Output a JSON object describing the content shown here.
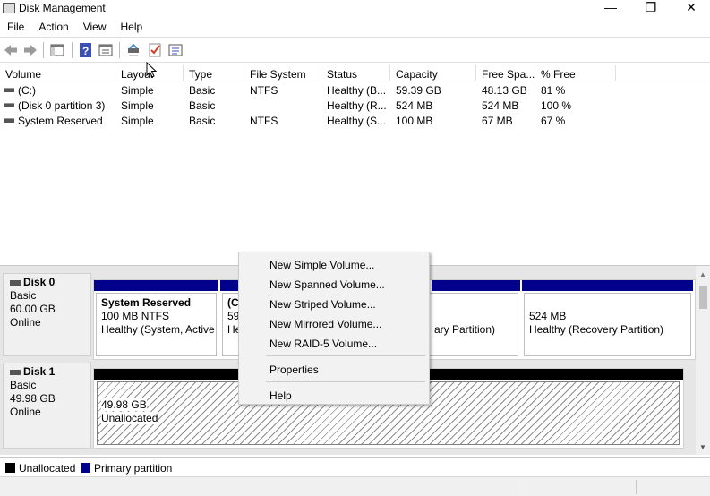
{
  "window": {
    "title": "Disk Management",
    "minimize_glyph": "—",
    "maximize_glyph": "❐",
    "close_glyph": "✕"
  },
  "menu": [
    "File",
    "Action",
    "View",
    "Help"
  ],
  "toolbar": {
    "icons": [
      "back-icon",
      "forward-icon",
      "show-hide-console-tree-icon",
      "help-icon",
      "properties-icon",
      "connect-disk-icon",
      "check-icon",
      "list-icon"
    ]
  },
  "volume_list": {
    "columns": [
      "Volume",
      "Layout",
      "Type",
      "File System",
      "Status",
      "Capacity",
      "Free Spa...",
      "% Free"
    ],
    "rows": [
      {
        "volume": "(C:)",
        "layout": "Simple",
        "type": "Basic",
        "fs": "NTFS",
        "status": "Healthy (B...",
        "capacity": "59.39 GB",
        "free": "48.13 GB",
        "pct": "81 %"
      },
      {
        "volume": "(Disk 0 partition 3)",
        "layout": "Simple",
        "type": "Basic",
        "fs": "",
        "status": "Healthy (R...",
        "capacity": "524 MB",
        "free": "524 MB",
        "pct": "100 %"
      },
      {
        "volume": "System Reserved",
        "layout": "Simple",
        "type": "Basic",
        "fs": "NTFS",
        "status": "Healthy (S...",
        "capacity": "100 MB",
        "free": "67 MB",
        "pct": "67 %"
      }
    ]
  },
  "disks": [
    {
      "name": "Disk 0",
      "type": "Basic",
      "size": "60.00 GB",
      "state": "Online",
      "partitions": [
        {
          "name": "System Reserved",
          "line1": "100 MB NTFS",
          "line2": "Healthy (System, Active"
        },
        {
          "name": "(C",
          "line1": "59",
          "line2": "He"
        },
        {
          "name": "",
          "line1": "",
          "line2": "ary Partition)"
        },
        {
          "name": "",
          "line1": "524 MB",
          "line2": "Healthy (Recovery Partition)"
        }
      ]
    },
    {
      "name": "Disk 1",
      "type": "Basic",
      "size": "49.98 GB",
      "state": "Online",
      "unallocated": {
        "size": "49.98 GB",
        "label": "Unallocated"
      }
    }
  ],
  "legend": [
    {
      "label": "Unallocated",
      "color": "#000000"
    },
    {
      "label": "Primary partition",
      "color": "#00008b"
    }
  ],
  "context_menu": {
    "items": [
      "New Simple Volume...",
      "New Spanned Volume...",
      "New Striped Volume...",
      "New Mirrored Volume...",
      "New RAID-5 Volume..."
    ],
    "properties": "Properties",
    "help": "Help"
  }
}
